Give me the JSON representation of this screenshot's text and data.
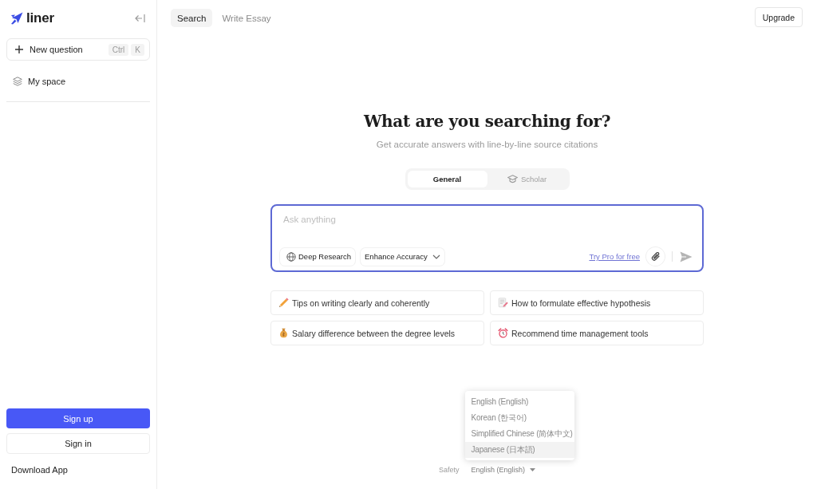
{
  "sidebar": {
    "logo": "liner",
    "new_question": {
      "label": "New question",
      "shortcut": [
        "Ctrl",
        "K"
      ]
    },
    "items": [
      {
        "label": "My space"
      }
    ],
    "sign_up": "Sign up",
    "sign_in": "Sign in",
    "download_app": "Download App"
  },
  "top_tabs": [
    {
      "label": "Search",
      "selected": true
    },
    {
      "label": "Write Essay",
      "selected": false
    }
  ],
  "upgrade_button": "Upgrade",
  "heading": "What are you searching for?",
  "subheading": "Get accurate answers with line-by-line source citations",
  "mode_tabs": [
    {
      "label": "General",
      "selected": true
    },
    {
      "label": "Scholar",
      "selected": false
    }
  ],
  "composer": {
    "placeholder": "Ask anything",
    "chips": [
      {
        "label": "Deep Research",
        "kind": "toggle"
      },
      {
        "label": "Enhance Accuracy",
        "kind": "dropdown"
      }
    ],
    "pro_link": "Try Pro for free"
  },
  "suggestions": [
    "Tips on writing clearly and coherently",
    "How to formulate effective hypothesis",
    "Salary difference between the degree levels",
    "Recommend time management tools"
  ],
  "language_menu": {
    "options": [
      {
        "label": "English (English)",
        "selected": false
      },
      {
        "label": "Korean (한국어)",
        "selected": false
      },
      {
        "label": "Simplified Chinese (简体中文)",
        "selected": false
      },
      {
        "label": "Japanese (日本語)",
        "selected": true
      }
    ]
  },
  "footer": {
    "safety": "Safety",
    "language": "English (English)"
  }
}
